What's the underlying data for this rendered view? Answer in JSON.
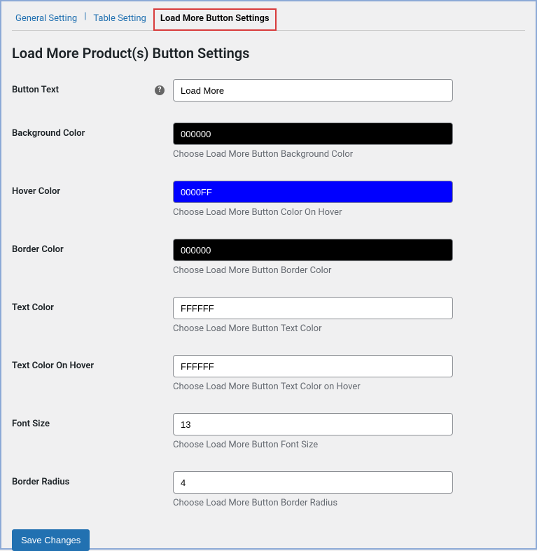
{
  "tabs": {
    "general": "General Setting",
    "table": "Table Setting",
    "loadmore": "Load More Button Settings"
  },
  "page_title": "Load More Product(s) Button Settings",
  "fields": {
    "button_text": {
      "label": "Button Text",
      "value": "Load More"
    },
    "background_color": {
      "label": "Background Color",
      "value": "000000",
      "desc": "Choose Load More Button Background Color"
    },
    "hover_color": {
      "label": "Hover Color",
      "value": "0000FF",
      "desc": "Choose Load More Button Color On Hover"
    },
    "border_color": {
      "label": "Border Color",
      "value": "000000",
      "desc": "Choose Load More Button Border Color"
    },
    "text_color": {
      "label": "Text Color",
      "value": "FFFFFF",
      "desc": "Choose Load More Button Text Color"
    },
    "text_color_hover": {
      "label": "Text Color On Hover",
      "value": "FFFFFF",
      "desc": "Choose Load More Button Text Color on Hover"
    },
    "font_size": {
      "label": "Font Size",
      "value": "13",
      "desc": "Choose Load More Button Font Size"
    },
    "border_radius": {
      "label": "Border Radius",
      "value": "4",
      "desc": "Choose Load More Button Border Radius"
    }
  },
  "save_button": "Save Changes"
}
